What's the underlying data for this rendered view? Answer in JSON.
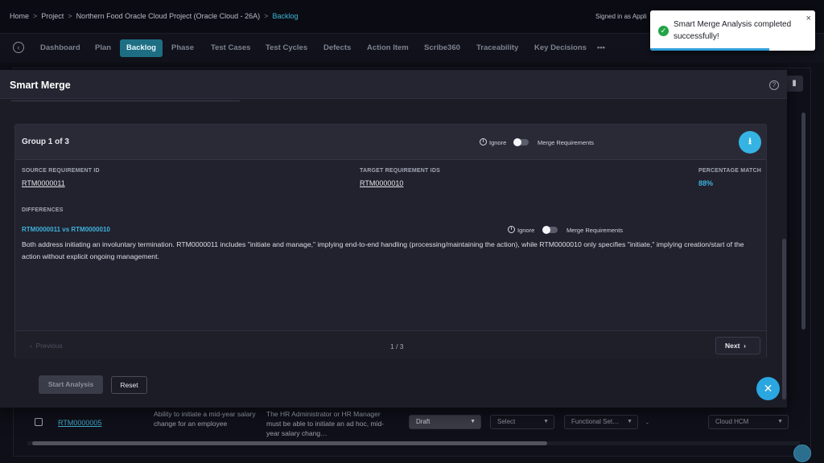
{
  "breadcrumb": {
    "items": [
      "Home",
      "Project",
      "Northern Food Oracle Cloud Project (Oracle Cloud - 26A)",
      "Backlog"
    ],
    "separator": ">",
    "signed_in": "Signed in as Appli"
  },
  "nav": {
    "tabs": [
      "Dashboard",
      "Plan",
      "Backlog",
      "Phase",
      "Test Cases",
      "Test Cycles",
      "Defects",
      "Action Item",
      "Scribe360",
      "Traceability",
      "Key Decisions"
    ],
    "active_tab": "Backlog",
    "more": "•••"
  },
  "toast": {
    "message": "Smart Merge Analysis completed successfully!",
    "close": "×",
    "check": "✓",
    "progress": 0.72
  },
  "modal": {
    "title": "Smart Merge",
    "help": "?",
    "group": {
      "title": "Group 1 of 3",
      "ignore_label": "Ignore",
      "merge_label": "Merge Requirements",
      "source_label": "SOURCE REQUIREMENT ID",
      "source_value": "RTM0000011",
      "target_label": "TARGET REQUIREMENT IDS",
      "target_value": "RTM0000010",
      "pct_label": "PERCENTAGE MATCH",
      "pct_value": "88%",
      "differences_label": "DIFFERENCES",
      "diff_pair": "RTM0000011 vs RTM0000010",
      "diff_ignore_label": "Ignore",
      "diff_merge_label": "Merge Requirements",
      "diff_text": "Both address initiating an involuntary termination. RTM0000011 includes \"initiate and manage,\" implying end-to-end handling (processing/maintaining the action), while RTM0000010 only specifies \"initiate,\" implying creation/start of the action without explicit ongoing management."
    },
    "pager": {
      "previous": "Previous",
      "page": "1 / 3",
      "next": "Next"
    },
    "start_analysis": "Start Analysis",
    "reset": "Reset"
  },
  "background_row": {
    "id": "RTM0000005",
    "title": "Ability to initiate a mid-year salary change for an employee",
    "description": "The HR Administrator or HR Manager must be able to initiate an ad hoc, mid-year salary chang…",
    "status": "Draft",
    "priority_placeholder": "Select",
    "type": "Functional Set…",
    "dash": "-",
    "module": "Cloud HCM"
  },
  "colors": {
    "accent": "#3fb1dc",
    "toast_success": "#22a447",
    "active_tab": "#1f6f84"
  }
}
